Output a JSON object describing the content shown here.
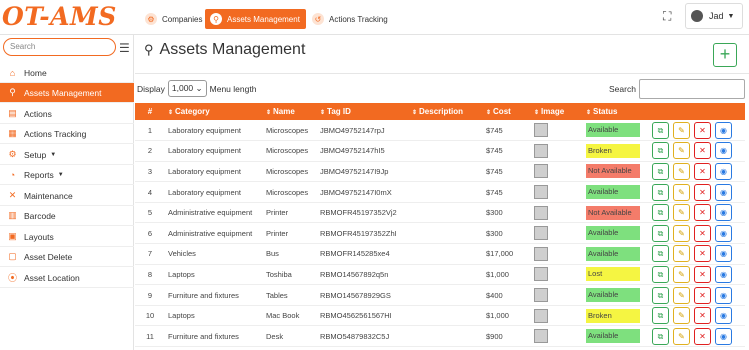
{
  "app": {
    "logo": "OT-AMS"
  },
  "topnav": [
    {
      "label": "Companies",
      "icon": "company-icon",
      "active": false
    },
    {
      "label": "Assets Management",
      "icon": "asset-icon",
      "active": true
    },
    {
      "label": "Actions Tracking",
      "icon": "history-icon",
      "active": false
    }
  ],
  "user": {
    "name": "Jad"
  },
  "sidebar": {
    "search_placeholder": "Search",
    "items": [
      {
        "label": "Home",
        "icon": "home-icon",
        "active": false,
        "dropdown": false
      },
      {
        "label": "Assets Management",
        "icon": "asset-icon",
        "active": true,
        "dropdown": false
      },
      {
        "label": "Actions",
        "icon": "actions-icon",
        "active": false,
        "dropdown": false
      },
      {
        "label": "Actions Tracking",
        "icon": "tracking-icon",
        "active": false,
        "dropdown": false
      },
      {
        "label": "Setup",
        "icon": "gear-icon",
        "active": false,
        "dropdown": true
      },
      {
        "label": "Reports",
        "icon": "reports-icon",
        "active": false,
        "dropdown": true
      },
      {
        "label": "Maintenance",
        "icon": "wrench-icon",
        "active": false,
        "dropdown": false
      },
      {
        "label": "Barcode",
        "icon": "barcode-icon",
        "active": false,
        "dropdown": false
      },
      {
        "label": "Layouts",
        "icon": "layouts-icon",
        "active": false,
        "dropdown": false
      },
      {
        "label": "Asset Delete",
        "icon": "delete-icon",
        "active": false,
        "dropdown": false
      },
      {
        "label": "Asset Location",
        "icon": "location-icon",
        "active": false,
        "dropdown": false
      }
    ]
  },
  "page": {
    "title": "Assets Management",
    "display_label": "Display",
    "page_size": "1,000",
    "menu_length_label": "Menu length",
    "search_label": "Search",
    "search_value": ""
  },
  "table": {
    "headers": [
      "#",
      "Category",
      "Name",
      "Tag ID",
      "Description",
      "Cost",
      "Image",
      "Status",
      ""
    ],
    "rows": [
      {
        "n": "1",
        "category": "Laboratory equipment",
        "name": "Microscopes",
        "tag": "JBMO49752147rpJ",
        "desc": "",
        "cost": "$745",
        "status": "Available",
        "status_color": "#7ee07e"
      },
      {
        "n": "2",
        "category": "Laboratory equipment",
        "name": "Microscopes",
        "tag": "JBMO49752147hI5",
        "desc": "",
        "cost": "$745",
        "status": "Broken",
        "status_color": "#f5f542"
      },
      {
        "n": "3",
        "category": "Laboratory equipment",
        "name": "Microscopes",
        "tag": "JBMO49752147I9Jp",
        "desc": "",
        "cost": "$745",
        "status": "Not Available",
        "status_color": "#f47c6a"
      },
      {
        "n": "4",
        "category": "Laboratory equipment",
        "name": "Microscopes",
        "tag": "JBMO49752147I0mX",
        "desc": "",
        "cost": "$745",
        "status": "Available",
        "status_color": "#7ee07e"
      },
      {
        "n": "5",
        "category": "Administrative equipment",
        "name": "Printer",
        "tag": "RBMOFR45197352Vj2",
        "desc": "",
        "cost": "$300",
        "status": "Not Available",
        "status_color": "#f47c6a"
      },
      {
        "n": "6",
        "category": "Administrative equipment",
        "name": "Printer",
        "tag": "RBMOFR45197352ZhI",
        "desc": "",
        "cost": "$300",
        "status": "Available",
        "status_color": "#7ee07e"
      },
      {
        "n": "7",
        "category": "Vehicles",
        "name": "Bus",
        "tag": "RBMOFR145285xe4",
        "desc": "",
        "cost": "$17,000",
        "status": "Available",
        "status_color": "#7ee07e"
      },
      {
        "n": "8",
        "category": "Laptops",
        "name": "Toshiba",
        "tag": "RBMO14567892q5n",
        "desc": "",
        "cost": "$1,000",
        "status": "Lost",
        "status_color": "#f5f542"
      },
      {
        "n": "9",
        "category": "Furniture and fixtures",
        "name": "Tables",
        "tag": "RBMO145678929GS",
        "desc": "",
        "cost": "$400",
        "status": "Available",
        "status_color": "#7ee07e"
      },
      {
        "n": "10",
        "category": "Laptops",
        "name": "Mac Book",
        "tag": "RBMO4562561567HI",
        "desc": "",
        "cost": "$1,000",
        "status": "Broken",
        "status_color": "#f5f542"
      },
      {
        "n": "11",
        "category": "Furniture and fixtures",
        "name": "Desk",
        "tag": "RBMO54879832C5J",
        "desc": "",
        "cost": "$900",
        "status": "Available",
        "status_color": "#7ee07e"
      }
    ]
  }
}
